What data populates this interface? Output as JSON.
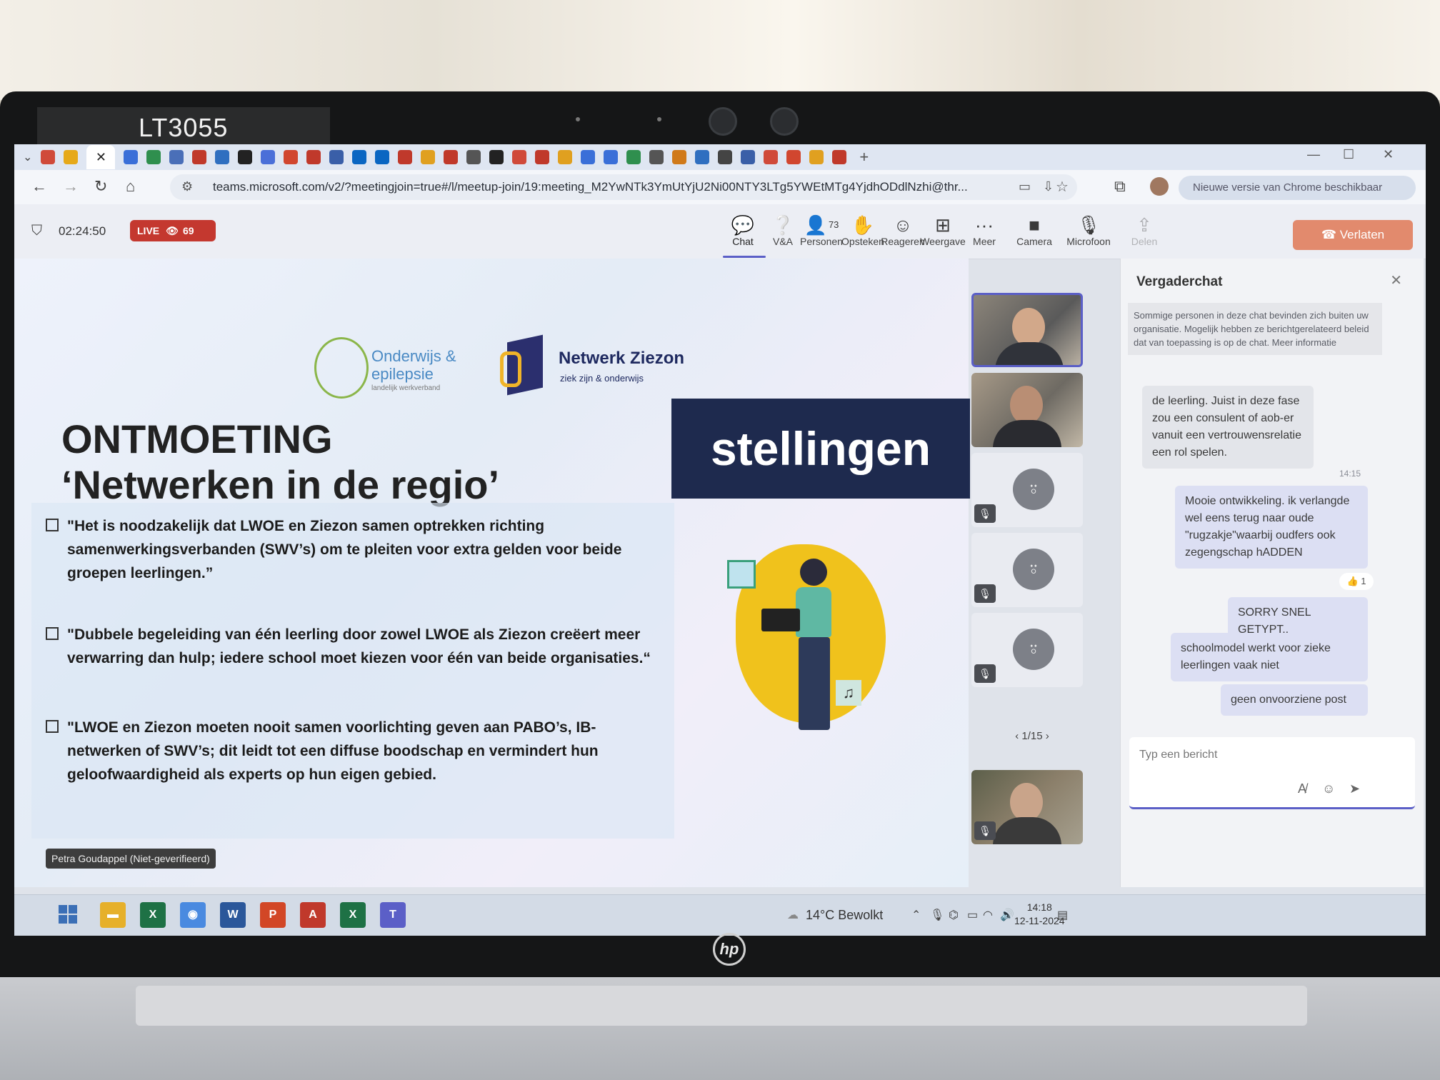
{
  "device": {
    "asset_label": "LT3055",
    "brand": "hp"
  },
  "browser": {
    "url": "teams.microsoft.com/v2/?meetingjoin=true#/l/meetup-join/19:meeting_M2YwNTk3YmUtYjU2Ni00NTY3LTg5YWEtMTg4YjdhODdlNzhi@thr...",
    "update_notice": "Nieuwe versie van Chrome beschikbaar",
    "tab_colors": [
      "#d04a3a",
      "#e6a91a",
      "#3a6fd8",
      "#2f8f4e",
      "#4a6fb8",
      "#c0392b",
      "#2f6fc0",
      "#222222",
      "#4a6fd8",
      "#d1462f",
      "#c0392b",
      "#3a5fa8",
      "#0a66c2",
      "#0a66c2",
      "#c0392b",
      "#e0a020",
      "#c0392b",
      "#555555",
      "#222222",
      "#d04a3a",
      "#c0392b",
      "#e0a020",
      "#3a6fd8",
      "#3a6fd8",
      "#2f8f4e",
      "#555555",
      "#d07a1a",
      "#2f6fc0",
      "#444444",
      "#3a5fa8",
      "#d04a3a",
      "#d1462f",
      "#e0a020",
      "#c0392b"
    ]
  },
  "meeting": {
    "timer": "02:24:50",
    "live_label": "LIVE",
    "viewer_count": "69",
    "toolbar": [
      {
        "name": "Chat",
        "icon": "chat-icon",
        "glyph": "💬"
      },
      {
        "name": "V&A",
        "icon": "qa-icon",
        "glyph": "❔"
      },
      {
        "name": "Personen",
        "icon": "people-icon",
        "glyph": "👤",
        "badge": "73"
      },
      {
        "name": "Opsteken",
        "icon": "raise-hand-icon",
        "glyph": "✋"
      },
      {
        "name": "Reageren",
        "icon": "react-icon",
        "glyph": "☺"
      },
      {
        "name": "Weergave",
        "icon": "view-icon",
        "glyph": "⊞"
      },
      {
        "name": "Meer",
        "icon": "more-icon",
        "glyph": "···"
      },
      {
        "name": "Camera",
        "icon": "camera-icon",
        "glyph": "■"
      },
      {
        "name": "Microfoon",
        "icon": "microphone-icon",
        "glyph": "🎙"
      },
      {
        "name": "Delen",
        "icon": "share-icon",
        "glyph": "⇪"
      }
    ],
    "leave_label": "Verlaten"
  },
  "slide": {
    "logo1_title": "Onderwijs & epilepsie",
    "logo1_subtitle": "landelijk werkverband",
    "logo2_title": "Netwerk Ziezon",
    "logo2_subtitle": "ziek zijn & onderwijs",
    "title_line1": "ONTMOETING",
    "title_line2": "‘Netwerken in de regio’",
    "banner": "stellingen",
    "bullets": [
      "\"Het is noodzakelijk dat LWOE en Ziezon samen optrekken richting samenwerkingsverbanden (SWV’s) om te pleiten voor extra gelden voor beide groepen leerlingen.”",
      "\"Dubbele begeleiding van één leerling door zowel LWOE als Ziezon creëert meer verwarring dan hulp; iedere school moet kiezen voor één van beide organisaties.“",
      "\"LWOE en Ziezon moeten nooit samen voorlichting geven aan PABO’s, IB-netwerken of SWV’s; dit leidt tot een diffuse boodschap en vermindert hun geloofwaardigheid als experts op hun eigen gebied."
    ],
    "presenter": "Petra Goudappel (Niet-geverifieerd)"
  },
  "participants": {
    "pager": "1/15"
  },
  "chat": {
    "title": "Vergaderchat",
    "notice": "Sommige personen in deze chat bevinden zich buiten uw organisatie. Mogelijk hebben ze berichtgerelateerd beleid dat van toepassing is op de chat. Meer informatie",
    "messages": [
      {
        "text": "de leerling. Juist in deze fase zou een consulent of aob-er vanuit een vertrouwensrelatie een rol spelen."
      },
      {
        "text": "Mooie ontwikkeling. ik verlangde wel eens terug naar oude \"rugzakje\"waarbij oudfers ook zegengschap hADDEN"
      },
      {
        "text": "SORRY SNEL GETYPT.."
      },
      {
        "text": "schoolmodel werkt voor zieke leerlingen vaak niet"
      },
      {
        "text": "geen onvoorziene post"
      }
    ],
    "time": "14:15",
    "reaction": "👍 1",
    "composer_placeholder": "Typ een bericht"
  },
  "taskbar": {
    "weather": "14°C  Bewolkt",
    "time": "14:18",
    "date": "12-11-2024",
    "apps": [
      {
        "icon": "file-explorer-icon",
        "color": "#e6b02a",
        "glyph": "▬"
      },
      {
        "icon": "excel-icon",
        "color": "#1e7145",
        "glyph": "X"
      },
      {
        "icon": "chrome-icon",
        "color": "#4a8ae0",
        "glyph": "◉"
      },
      {
        "icon": "word-icon",
        "color": "#2b579a",
        "glyph": "W"
      },
      {
        "icon": "powerpoint-icon",
        "color": "#d24726",
        "glyph": "P"
      },
      {
        "icon": "pdf-icon",
        "color": "#c0392b",
        "glyph": "A"
      },
      {
        "icon": "excel-icon",
        "color": "#1e7145",
        "glyph": "X"
      },
      {
        "icon": "teams-icon",
        "color": "#5b5fc7",
        "glyph": "T"
      }
    ]
  }
}
